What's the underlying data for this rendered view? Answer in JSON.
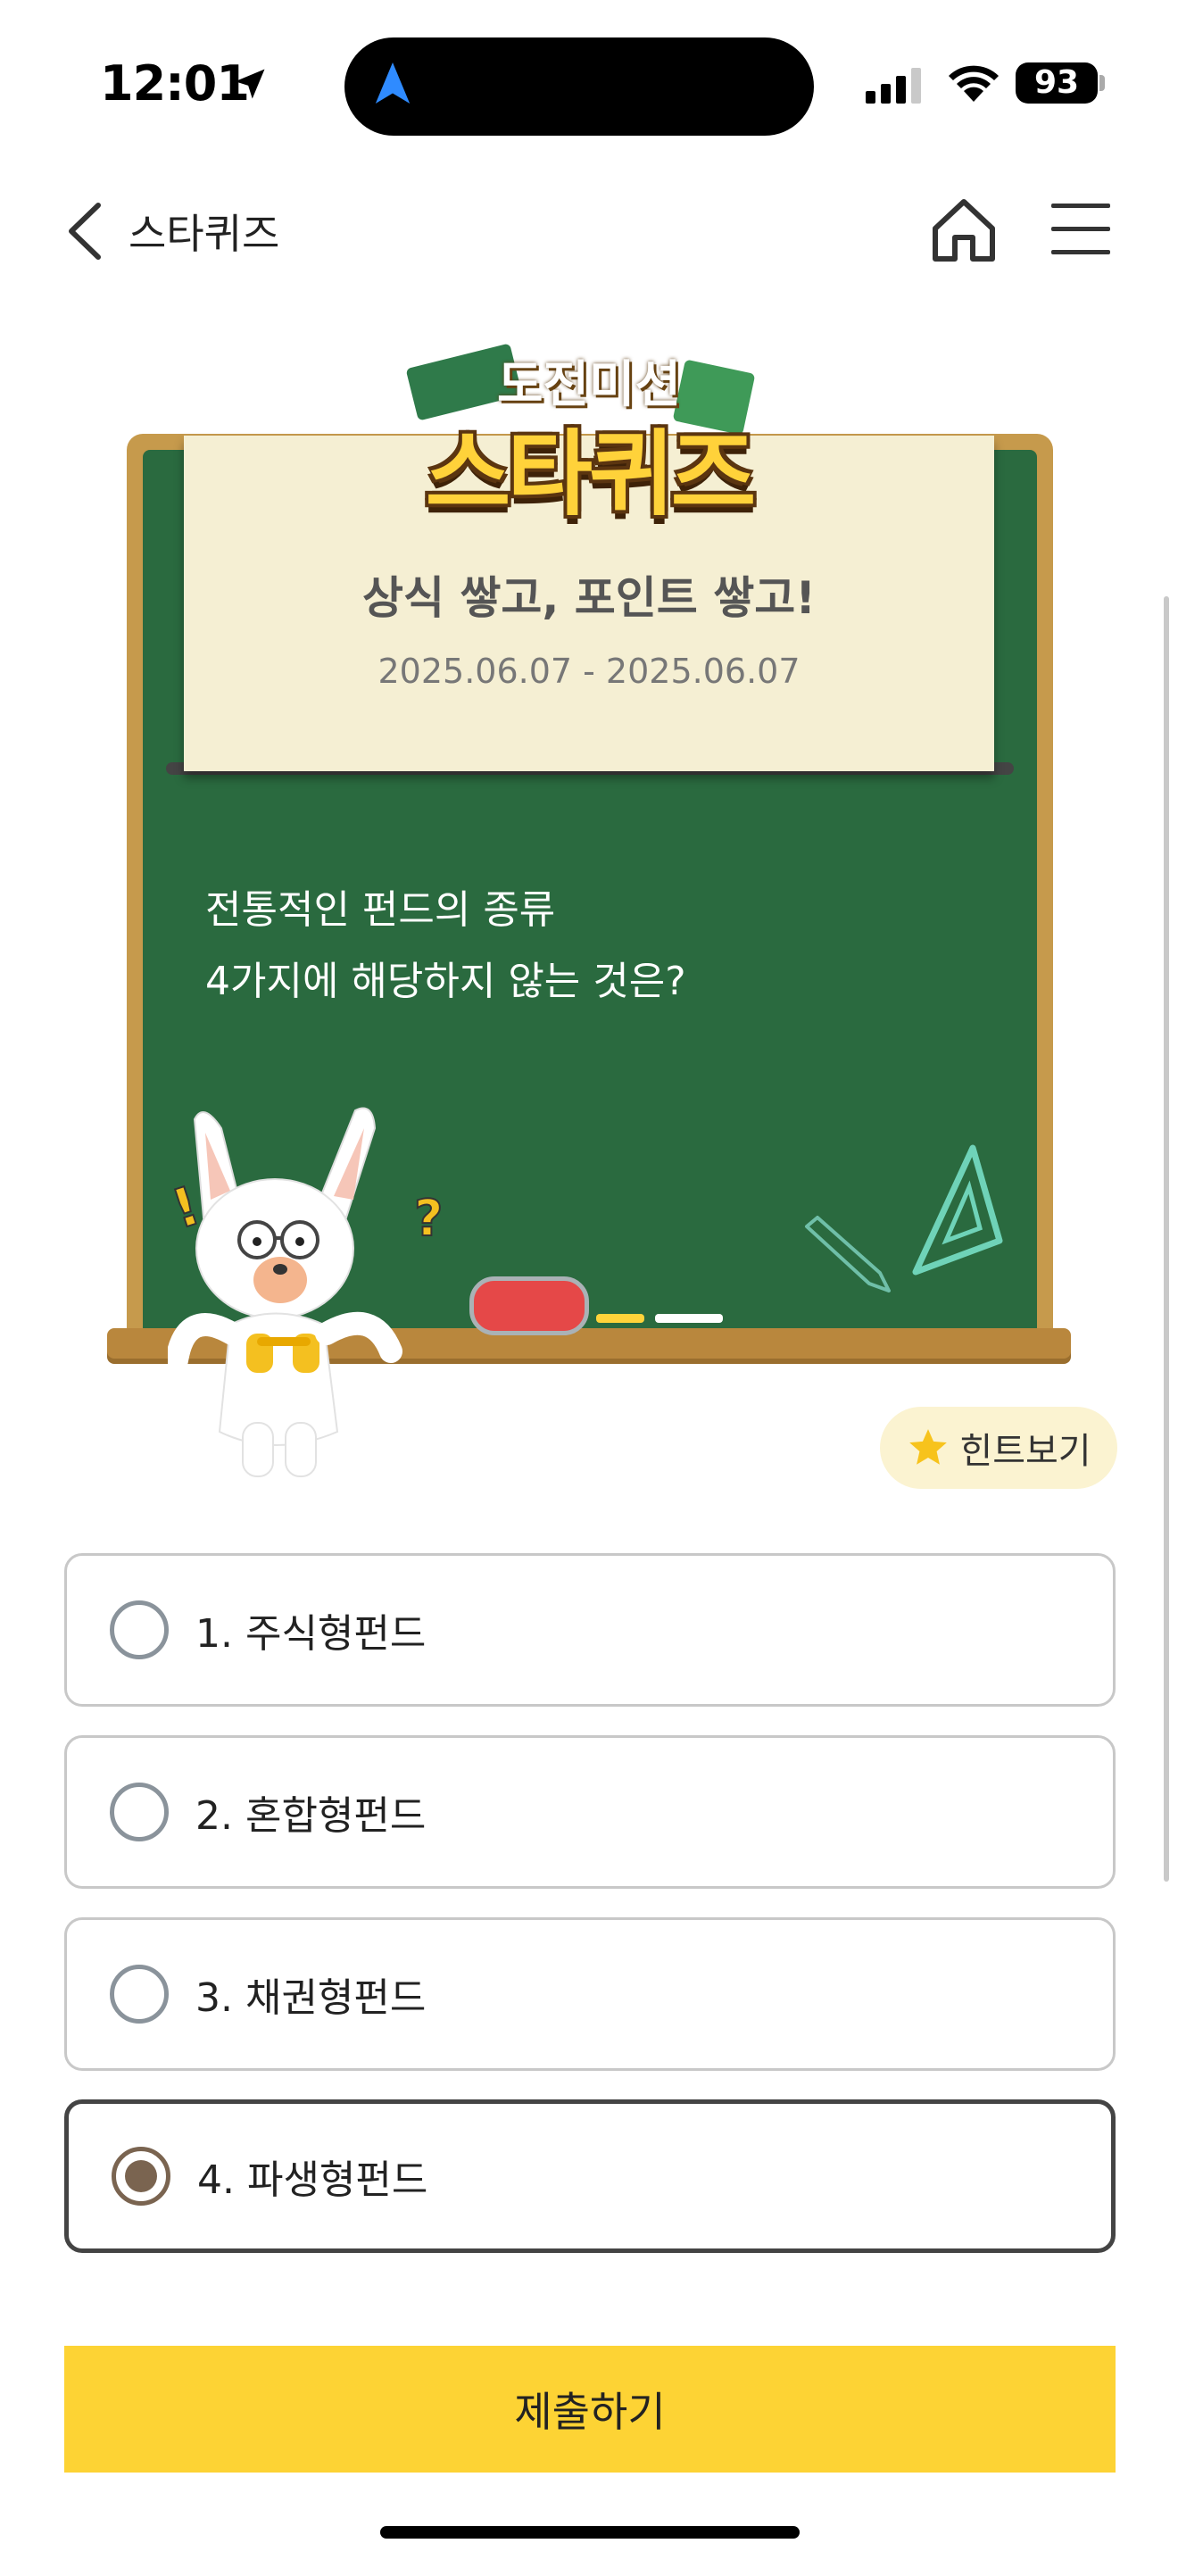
{
  "status_bar": {
    "time": "12:01",
    "battery": "93"
  },
  "header": {
    "title": "스타퀴즈"
  },
  "quiz": {
    "logo_top": "도전미션",
    "logo_main": "스타퀴즈",
    "subtitle": "상식 쌓고, 포인트 쌓고!",
    "date_range": "2025.06.07 - 2025.06.07",
    "question": "전통적인 펀드의 종류\n4가지에 해당하지 않는 것은?",
    "hint_label": "힌트보기",
    "options": [
      {
        "label": "1. 주식형펀드",
        "selected": false
      },
      {
        "label": "2. 혼합형펀드",
        "selected": false
      },
      {
        "label": "3. 채권형펀드",
        "selected": false
      },
      {
        "label": "4. 파생형펀드",
        "selected": true
      }
    ],
    "submit_label": "제출하기"
  },
  "colors": {
    "board": "#2a6a3f",
    "board_frame": "#c69a4c",
    "paper": "#f5efd3",
    "submit": "#fdd334",
    "hint_bg": "#fbf3d1",
    "selected_radio": "#7a6450"
  }
}
